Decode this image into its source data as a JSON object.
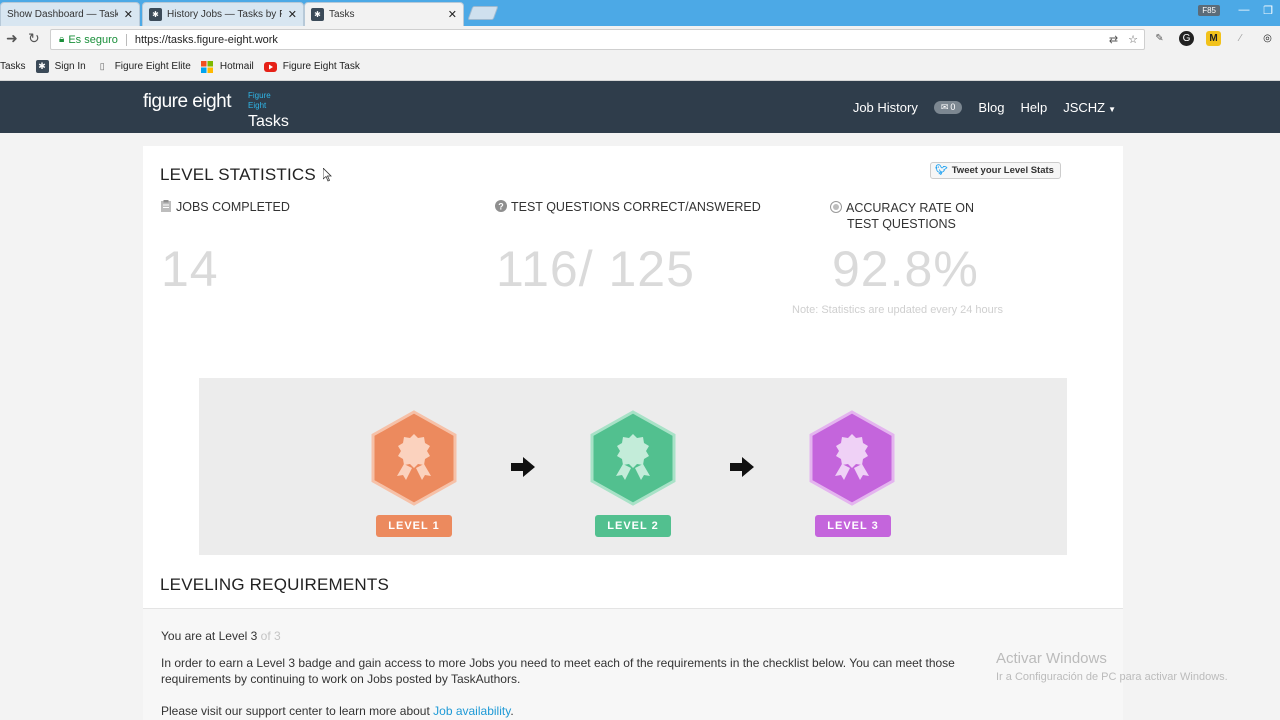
{
  "browser": {
    "tabs": [
      {
        "label": "Show Dashboard — Task",
        "active": false
      },
      {
        "label": "History Jobs — Tasks by F",
        "active": false
      },
      {
        "label": "Tasks",
        "active": true
      }
    ],
    "window_badge": "F85",
    "security_label": "Es seguro",
    "url": "https://tasks.figure-eight.work",
    "bookmarks": [
      "Tasks",
      "Sign In",
      "Figure Eight Elite",
      "Hotmail",
      "Figure Eight Task"
    ]
  },
  "header": {
    "logo_main": "figure eight",
    "logo_sub_1": "Figure",
    "logo_sub_2": "Eight",
    "logo_tasks": "Tasks",
    "nav": {
      "job_history": "Job History",
      "messages_count": "0",
      "blog": "Blog",
      "help": "Help",
      "user": "JSCHZ"
    }
  },
  "level_stats": {
    "title": "LEVEL STATISTICS",
    "tweet_label": "Tweet your Level Stats",
    "jobs_completed": {
      "label": "JOBS COMPLETED",
      "value": "14"
    },
    "test_questions": {
      "label": "TEST QUESTIONS CORRECT/ANSWERED",
      "value": "116/ 125"
    },
    "accuracy": {
      "label_line1": "ACCURACY RATE ON",
      "label_line2": "TEST QUESTIONS",
      "value": "92.8%"
    },
    "note": "Note: Statistics are updated every 24 hours"
  },
  "levels": [
    {
      "label": "LEVEL 1",
      "color": "#ec8a5e"
    },
    {
      "label": "LEVEL 2",
      "color": "#52c08f"
    },
    {
      "label": "LEVEL 3",
      "color": "#c465dc"
    }
  ],
  "leveling": {
    "title": "LEVELING REQUIREMENTS",
    "current_prefix": "You are at Level 3",
    "current_suffix": "of 3",
    "desc_line1": "In order to earn a Level 3 badge and gain access to more Jobs you need to meet each of the requirements in the checklist below. You can meet those",
    "desc_line2": "requirements by continuing to work on Jobs posted by TaskAuthors.",
    "support_prefix": "Please visit our support center to learn more about",
    "support_link": "Job availability",
    "support_suffix": "."
  },
  "watermark": {
    "line1": "Activar Windows",
    "line2": "Ir a Configuración de PC para activar Windows."
  }
}
